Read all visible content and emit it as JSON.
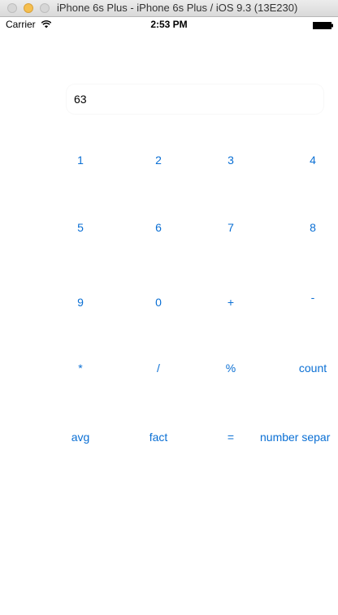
{
  "window": {
    "title": "iPhone 6s Plus - iPhone 6s Plus / iOS 9.3 (13E230)"
  },
  "status_bar": {
    "carrier": "Carrier",
    "time": "2:53 PM"
  },
  "display": {
    "value": "63"
  },
  "keys": {
    "row1": [
      "1",
      "2",
      "3",
      "4"
    ],
    "row2": [
      "5",
      "6",
      "7",
      "8"
    ],
    "row3": [
      "9",
      "0",
      "+",
      "-"
    ],
    "row4": [
      "*",
      "/",
      "%",
      "count"
    ],
    "row5": [
      "avg",
      "fact",
      "=",
      "number separ"
    ]
  },
  "colors": {
    "button_tint": "#0a6fd4",
    "minimize_traffic_light": "#f5bf4f"
  },
  "icons": [
    "wifi-icon",
    "battery-icon"
  ]
}
